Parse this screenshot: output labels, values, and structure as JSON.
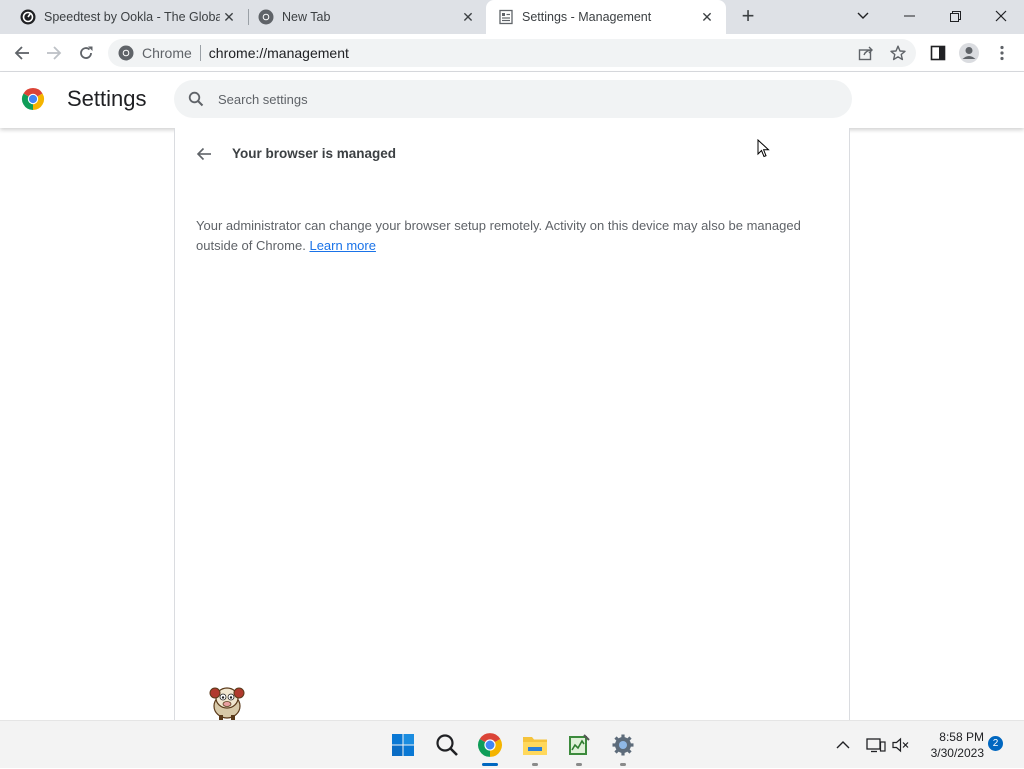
{
  "tabs": [
    {
      "title": "Speedtest by Ookla - The Global",
      "icon": "speedtest-icon",
      "active": false
    },
    {
      "title": "New Tab",
      "icon": "chrome-icon",
      "active": false
    },
    {
      "title": "Settings - Management",
      "icon": "settings-page-icon",
      "active": true
    }
  ],
  "omnibox": {
    "site_label": "Chrome",
    "url": "chrome://management"
  },
  "settings": {
    "title": "Settings",
    "search_placeholder": "Search settings"
  },
  "page": {
    "heading": "Your browser is managed",
    "description": "Your administrator can change your browser setup remotely. Activity on this device may also be managed outside of Chrome.",
    "learn_more": "Learn more"
  },
  "taskbar": {
    "time": "8:58 PM",
    "date": "3/30/2023",
    "notifications": "2"
  },
  "colors": {
    "accent": "#1a73e8",
    "taskbar_accent": "#0067c0"
  }
}
